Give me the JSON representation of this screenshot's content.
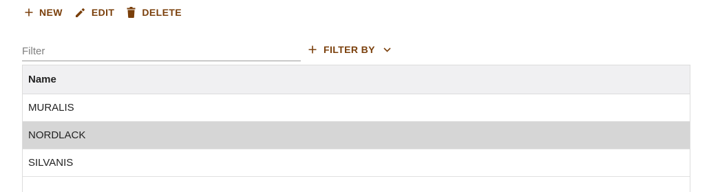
{
  "toolbar": {
    "new_label": "NEW",
    "edit_label": "EDIT",
    "delete_label": "DELETE"
  },
  "filter": {
    "placeholder": "Filter",
    "value": "",
    "filter_by_label": "FILTER BY"
  },
  "table": {
    "columns": [
      "Name"
    ],
    "rows": [
      {
        "name": "MURALIS",
        "selected": false
      },
      {
        "name": "NORDLACK",
        "selected": true
      },
      {
        "name": "SILVANIS",
        "selected": false
      }
    ]
  },
  "colors": {
    "accent": "#7a3f0b",
    "header_bg": "#f0f0f2",
    "selected_row_bg": "#d6d6d6"
  },
  "icons": {
    "new": "plus-icon",
    "edit": "pencil-icon",
    "delete": "trash-icon",
    "filter_by": "plus-icon",
    "filter_dropdown": "chevron-down-icon"
  }
}
